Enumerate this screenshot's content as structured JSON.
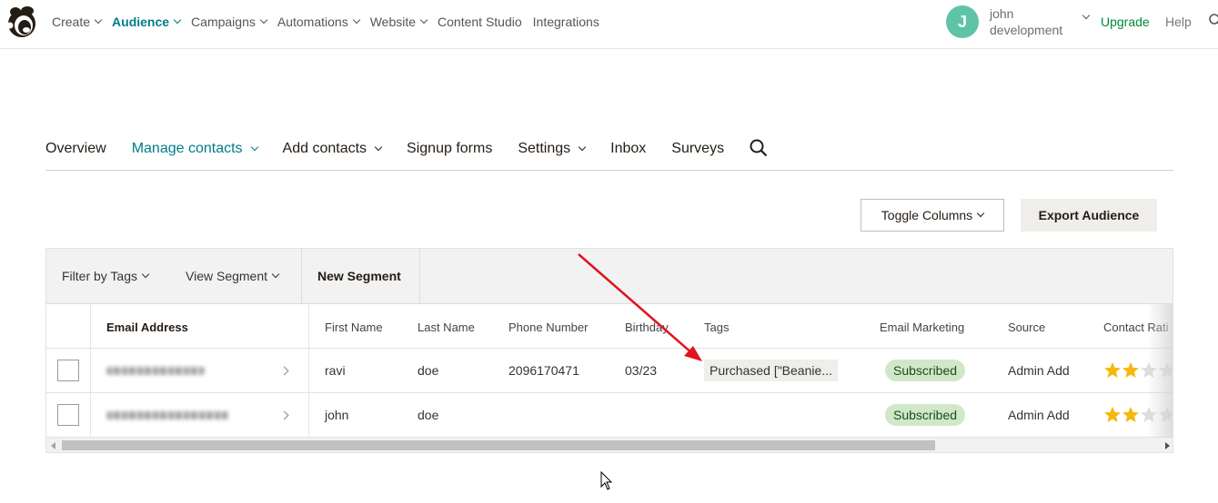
{
  "topnav": {
    "items": [
      {
        "label": "Create",
        "dropdown": true,
        "active": false
      },
      {
        "label": "Audience",
        "dropdown": true,
        "active": true
      },
      {
        "label": "Campaigns",
        "dropdown": true,
        "active": false
      },
      {
        "label": "Automations",
        "dropdown": true,
        "active": false
      },
      {
        "label": "Website",
        "dropdown": true,
        "active": false
      },
      {
        "label": "Content Studio",
        "dropdown": false,
        "active": false
      },
      {
        "label": "Integrations",
        "dropdown": false,
        "active": false
      }
    ],
    "avatar_initial": "J",
    "account_line1": "john",
    "account_line2": "development",
    "upgrade_label": "Upgrade",
    "help_label": "Help"
  },
  "subnav": {
    "items": [
      {
        "label": "Overview",
        "dropdown": false,
        "active": false
      },
      {
        "label": "Manage contacts",
        "dropdown": true,
        "active": true
      },
      {
        "label": "Add contacts",
        "dropdown": true,
        "active": false
      },
      {
        "label": "Signup forms",
        "dropdown": false,
        "active": false
      },
      {
        "label": "Settings",
        "dropdown": true,
        "active": false
      },
      {
        "label": "Inbox",
        "dropdown": false,
        "active": false
      },
      {
        "label": "Surveys",
        "dropdown": false,
        "active": false
      }
    ]
  },
  "actions": {
    "toggle_columns_label": "Toggle Columns",
    "export_label": "Export Audience"
  },
  "filters": {
    "filter_by_tags_label": "Filter by Tags",
    "view_segment_label": "View Segment",
    "new_segment_label": "New Segment"
  },
  "table": {
    "columns": {
      "email": "Email Address",
      "first_name": "First Name",
      "last_name": "Last Name",
      "phone": "Phone Number",
      "birthday": "Birthday",
      "tags": "Tags",
      "email_marketing": "Email Marketing",
      "source": "Source",
      "rating": "Contact Rati"
    },
    "rows": [
      {
        "first_name": "ravi",
        "last_name": "doe",
        "phone": "2096170471",
        "birthday": "03/23",
        "tags": "Purchased [\"Beanie...",
        "email_marketing": "Subscribed",
        "source": "Admin Add",
        "rating_stars": 2
      },
      {
        "first_name": "john",
        "last_name": "doe",
        "phone": "",
        "birthday": "",
        "tags": "",
        "email_marketing": "Subscribed",
        "source": "Admin Add",
        "rating_stars": 2
      }
    ]
  },
  "colors": {
    "accent": "#007c89",
    "upgrade": "#00883a",
    "avatar": "#5fc3a7",
    "subscribed_bg": "#d0e8c9",
    "star": "#f5b80b",
    "annotation_arrow": "#e0141c"
  },
  "icons": {
    "logo": "mailchimp-freddie-icon",
    "search": "search-icon",
    "star": "star-icon",
    "chevron": "chevron-right-icon"
  }
}
